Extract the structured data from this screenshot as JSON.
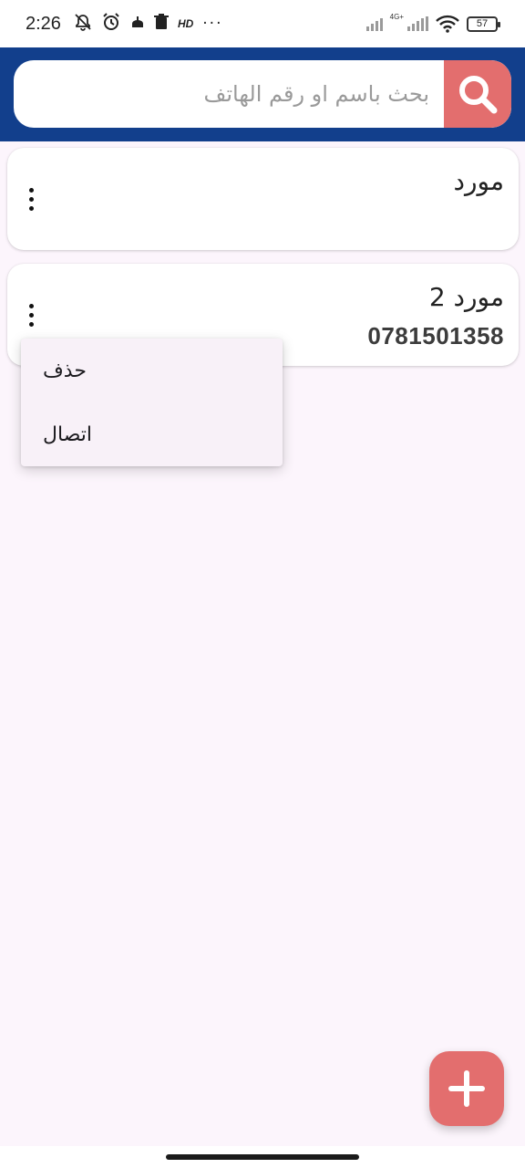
{
  "status_bar": {
    "time": "2:26",
    "notification_icons": [
      "bell-off-icon",
      "alarm-icon",
      "mosque-icon",
      "trash-icon",
      "hd-icon",
      "more-dots-icon"
    ],
    "network_label": "4G+",
    "battery": "57"
  },
  "search": {
    "placeholder": "بحث باسم او رقم الهاتف",
    "value": ""
  },
  "suppliers": [
    {
      "name": "مورد",
      "phone": ""
    },
    {
      "name": "مورد 2",
      "phone": "0781501358"
    }
  ],
  "menu": {
    "items": [
      "حذف",
      "اتصال"
    ]
  },
  "fab": {
    "icon": "plus-icon"
  },
  "colors": {
    "app_bar": "#123f8c",
    "accent": "#e36e6e",
    "background": "#fcf5fc"
  }
}
